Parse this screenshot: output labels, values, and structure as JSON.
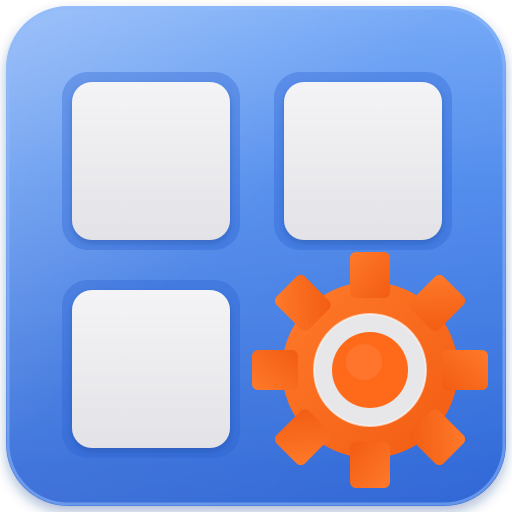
{
  "icon": {
    "semantic": "apps-settings-icon",
    "description_colors": {
      "base_blue": "#3f7fe8",
      "base_blue_dark": "#2a5fcf",
      "base_blue_light": "#6fa6f7",
      "tile_fill": "#e9e9ec",
      "tile_fill_light": "#f3f3f5",
      "gear_orange": "#ff6a1a",
      "gear_orange_dark": "#e85a10",
      "gear_ring": "#e8e8ea"
    },
    "tiles": [
      {
        "name": "top-left-tile"
      },
      {
        "name": "top-right-tile"
      },
      {
        "name": "bottom-left-tile"
      }
    ]
  }
}
